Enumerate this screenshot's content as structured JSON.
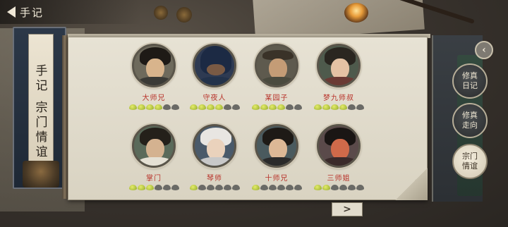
{
  "header": {
    "back_label": "手记"
  },
  "left_tabs": [
    {
      "label": "手记",
      "chars": [
        "手",
        "记"
      ]
    },
    {
      "label": "宗门情谊",
      "chars": [
        "宗",
        "门",
        "情",
        "谊"
      ]
    }
  ],
  "characters": [
    {
      "name": "大师兄",
      "rating": 4,
      "max": 6
    },
    {
      "name": "守夜人",
      "rating": 4,
      "max": 6
    },
    {
      "name": "某园子",
      "rating": 4,
      "max": 6
    },
    {
      "name": "梦九师叔",
      "rating": 4,
      "max": 6
    },
    {
      "name": "掌门",
      "rating": 3,
      "max": 6
    },
    {
      "name": "琴师",
      "rating": 1,
      "max": 6
    },
    {
      "name": "十师兄",
      "rating": 1,
      "max": 6
    },
    {
      "name": "三师姐",
      "rating": 2,
      "max": 6
    }
  ],
  "side_buttons": [
    {
      "line1": "修真",
      "line2": "日记",
      "active": false
    },
    {
      "line1": "修真",
      "line2": "走向",
      "active": false
    },
    {
      "line1": "宗门",
      "line2": "情谊",
      "active": true
    }
  ],
  "next_label": ">",
  "collapse_label": "‹",
  "colors": {
    "name_red": "#b8322a",
    "leaf_on": "#c9d84a",
    "leaf_off": "#6a6a66"
  }
}
